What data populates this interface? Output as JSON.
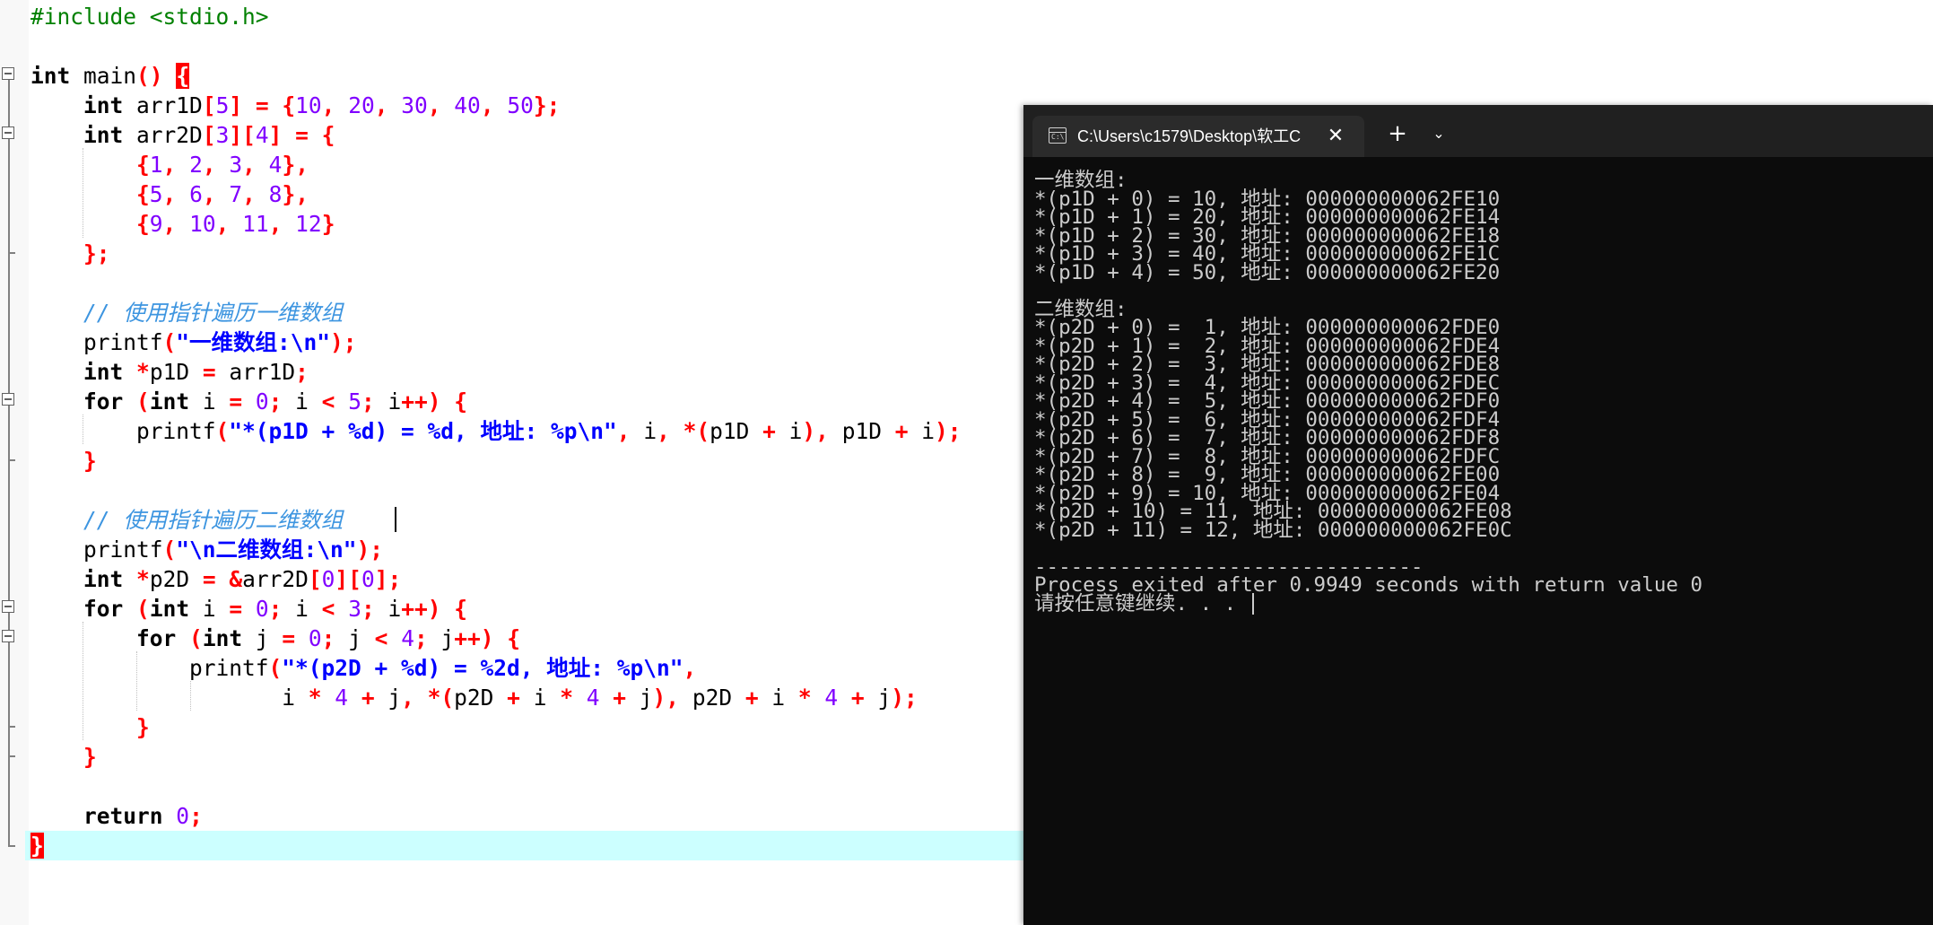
{
  "editor": {
    "lines": [
      [
        [
          "pp",
          "#include <stdio.h>"
        ]
      ],
      [],
      [
        [
          "kw",
          "int"
        ],
        [
          "id",
          " main"
        ],
        [
          "op",
          "()"
        ],
        [
          "id",
          " "
        ],
        [
          "brace-hl",
          "{"
        ]
      ],
      [
        [
          "id",
          "    "
        ],
        [
          "kw",
          "int"
        ],
        [
          "id",
          " arr1D"
        ],
        [
          "op",
          "["
        ],
        [
          "num",
          "5"
        ],
        [
          "op",
          "]"
        ],
        [
          "id",
          " "
        ],
        [
          "op",
          "="
        ],
        [
          "id",
          " "
        ],
        [
          "op",
          "{"
        ],
        [
          "num",
          "10"
        ],
        [
          "op",
          ","
        ],
        [
          "id",
          " "
        ],
        [
          "num",
          "20"
        ],
        [
          "op",
          ","
        ],
        [
          "id",
          " "
        ],
        [
          "num",
          "30"
        ],
        [
          "op",
          ","
        ],
        [
          "id",
          " "
        ],
        [
          "num",
          "40"
        ],
        [
          "op",
          ","
        ],
        [
          "id",
          " "
        ],
        [
          "num",
          "50"
        ],
        [
          "op",
          "};"
        ]
      ],
      [
        [
          "id",
          "    "
        ],
        [
          "kw",
          "int"
        ],
        [
          "id",
          " arr2D"
        ],
        [
          "op",
          "["
        ],
        [
          "num",
          "3"
        ],
        [
          "op",
          "]["
        ],
        [
          "num",
          "4"
        ],
        [
          "op",
          "]"
        ],
        [
          "id",
          " "
        ],
        [
          "op",
          "="
        ],
        [
          "id",
          " "
        ],
        [
          "op",
          "{"
        ]
      ],
      [
        [
          "id",
          "        "
        ],
        [
          "op",
          "{"
        ],
        [
          "num",
          "1"
        ],
        [
          "op",
          ","
        ],
        [
          "id",
          " "
        ],
        [
          "num",
          "2"
        ],
        [
          "op",
          ","
        ],
        [
          "id",
          " "
        ],
        [
          "num",
          "3"
        ],
        [
          "op",
          ","
        ],
        [
          "id",
          " "
        ],
        [
          "num",
          "4"
        ],
        [
          "op",
          "},"
        ]
      ],
      [
        [
          "id",
          "        "
        ],
        [
          "op",
          "{"
        ],
        [
          "num",
          "5"
        ],
        [
          "op",
          ","
        ],
        [
          "id",
          " "
        ],
        [
          "num",
          "6"
        ],
        [
          "op",
          ","
        ],
        [
          "id",
          " "
        ],
        [
          "num",
          "7"
        ],
        [
          "op",
          ","
        ],
        [
          "id",
          " "
        ],
        [
          "num",
          "8"
        ],
        [
          "op",
          "},"
        ]
      ],
      [
        [
          "id",
          "        "
        ],
        [
          "op",
          "{"
        ],
        [
          "num",
          "9"
        ],
        [
          "op",
          ","
        ],
        [
          "id",
          " "
        ],
        [
          "num",
          "10"
        ],
        [
          "op",
          ","
        ],
        [
          "id",
          " "
        ],
        [
          "num",
          "11"
        ],
        [
          "op",
          ","
        ],
        [
          "id",
          " "
        ],
        [
          "num",
          "12"
        ],
        [
          "op",
          "}"
        ]
      ],
      [
        [
          "id",
          "    "
        ],
        [
          "op",
          "};"
        ]
      ],
      [],
      [
        [
          "id",
          "    "
        ],
        [
          "cmt",
          "// 使用指针遍历一维数组"
        ]
      ],
      [
        [
          "id",
          "    printf"
        ],
        [
          "op",
          "("
        ],
        [
          "str",
          "\"一维数组:\\n\""
        ],
        [
          "op",
          ");"
        ]
      ],
      [
        [
          "id",
          "    "
        ],
        [
          "kw",
          "int"
        ],
        [
          "id",
          " "
        ],
        [
          "op",
          "*"
        ],
        [
          "id",
          "p1D "
        ],
        [
          "op",
          "="
        ],
        [
          "id",
          " arr1D"
        ],
        [
          "op",
          ";"
        ]
      ],
      [
        [
          "id",
          "    "
        ],
        [
          "kw",
          "for"
        ],
        [
          "id",
          " "
        ],
        [
          "op",
          "("
        ],
        [
          "kw",
          "int"
        ],
        [
          "id",
          " i "
        ],
        [
          "op",
          "="
        ],
        [
          "id",
          " "
        ],
        [
          "num",
          "0"
        ],
        [
          "op",
          ";"
        ],
        [
          "id",
          " i "
        ],
        [
          "op",
          "<"
        ],
        [
          "id",
          " "
        ],
        [
          "num",
          "5"
        ],
        [
          "op",
          ";"
        ],
        [
          "id",
          " i"
        ],
        [
          "op",
          "++)"
        ],
        [
          "id",
          " "
        ],
        [
          "op",
          "{"
        ]
      ],
      [
        [
          "id",
          "        printf"
        ],
        [
          "op",
          "("
        ],
        [
          "str",
          "\"*(p1D + %d) = %d, 地址: %p\\n\""
        ],
        [
          "op",
          ","
        ],
        [
          "id",
          " i"
        ],
        [
          "op",
          ","
        ],
        [
          "id",
          " "
        ],
        [
          "op",
          "*("
        ],
        [
          "id",
          "p1D "
        ],
        [
          "op",
          "+"
        ],
        [
          "id",
          " i"
        ],
        [
          "op",
          "),"
        ],
        [
          "id",
          " p1D "
        ],
        [
          "op",
          "+"
        ],
        [
          "id",
          " i"
        ],
        [
          "op",
          ");"
        ]
      ],
      [
        [
          "id",
          "    "
        ],
        [
          "op",
          "}"
        ]
      ],
      [],
      [
        [
          "id",
          "    "
        ],
        [
          "cmt",
          "// 使用指针遍历二维数组"
        ]
      ],
      [
        [
          "id",
          "    printf"
        ],
        [
          "op",
          "("
        ],
        [
          "str",
          "\"\\n二维数组:\\n\""
        ],
        [
          "op",
          ");"
        ]
      ],
      [
        [
          "id",
          "    "
        ],
        [
          "kw",
          "int"
        ],
        [
          "id",
          " "
        ],
        [
          "op",
          "*"
        ],
        [
          "id",
          "p2D "
        ],
        [
          "op",
          "="
        ],
        [
          "id",
          " "
        ],
        [
          "op",
          "&"
        ],
        [
          "id",
          "arr2D"
        ],
        [
          "op",
          "["
        ],
        [
          "num",
          "0"
        ],
        [
          "op",
          "]["
        ],
        [
          "num",
          "0"
        ],
        [
          "op",
          "];"
        ]
      ],
      [
        [
          "id",
          "    "
        ],
        [
          "kw",
          "for"
        ],
        [
          "id",
          " "
        ],
        [
          "op",
          "("
        ],
        [
          "kw",
          "int"
        ],
        [
          "id",
          " i "
        ],
        [
          "op",
          "="
        ],
        [
          "id",
          " "
        ],
        [
          "num",
          "0"
        ],
        [
          "op",
          ";"
        ],
        [
          "id",
          " i "
        ],
        [
          "op",
          "<"
        ],
        [
          "id",
          " "
        ],
        [
          "num",
          "3"
        ],
        [
          "op",
          ";"
        ],
        [
          "id",
          " i"
        ],
        [
          "op",
          "++)"
        ],
        [
          "id",
          " "
        ],
        [
          "op",
          "{"
        ]
      ],
      [
        [
          "id",
          "        "
        ],
        [
          "kw",
          "for"
        ],
        [
          "id",
          " "
        ],
        [
          "op",
          "("
        ],
        [
          "kw",
          "int"
        ],
        [
          "id",
          " j "
        ],
        [
          "op",
          "="
        ],
        [
          "id",
          " "
        ],
        [
          "num",
          "0"
        ],
        [
          "op",
          ";"
        ],
        [
          "id",
          " j "
        ],
        [
          "op",
          "<"
        ],
        [
          "id",
          " "
        ],
        [
          "num",
          "4"
        ],
        [
          "op",
          ";"
        ],
        [
          "id",
          " j"
        ],
        [
          "op",
          "++)"
        ],
        [
          "id",
          " "
        ],
        [
          "op",
          "{"
        ]
      ],
      [
        [
          "id",
          "            printf"
        ],
        [
          "op",
          "("
        ],
        [
          "str",
          "\"*(p2D + %d) = %2d, 地址: %p\\n\""
        ],
        [
          "op",
          ","
        ]
      ],
      [
        [
          "id",
          "                   i "
        ],
        [
          "op",
          "*"
        ],
        [
          "id",
          " "
        ],
        [
          "num",
          "4"
        ],
        [
          "id",
          " "
        ],
        [
          "op",
          "+"
        ],
        [
          "id",
          " j"
        ],
        [
          "op",
          ","
        ],
        [
          "id",
          " "
        ],
        [
          "op",
          "*("
        ],
        [
          "id",
          "p2D "
        ],
        [
          "op",
          "+"
        ],
        [
          "id",
          " i "
        ],
        [
          "op",
          "*"
        ],
        [
          "id",
          " "
        ],
        [
          "num",
          "4"
        ],
        [
          "id",
          " "
        ],
        [
          "op",
          "+"
        ],
        [
          "id",
          " j"
        ],
        [
          "op",
          "),"
        ],
        [
          "id",
          " p2D "
        ],
        [
          "op",
          "+"
        ],
        [
          "id",
          " i "
        ],
        [
          "op",
          "*"
        ],
        [
          "id",
          " "
        ],
        [
          "num",
          "4"
        ],
        [
          "id",
          " "
        ],
        [
          "op",
          "+"
        ],
        [
          "id",
          " j"
        ],
        [
          "op",
          ");"
        ]
      ],
      [
        [
          "id",
          "        "
        ],
        [
          "op",
          "}"
        ]
      ],
      [
        [
          "id",
          "    "
        ],
        [
          "op",
          "}"
        ]
      ],
      [],
      [
        [
          "id",
          "    "
        ],
        [
          "kw",
          "return"
        ],
        [
          "id",
          " "
        ],
        [
          "num",
          "0"
        ],
        [
          "op",
          ";"
        ]
      ],
      [
        [
          "brace-hl",
          "}"
        ]
      ]
    ]
  },
  "terminal": {
    "tab_title": "C:\\Users\\c1579\\Desktop\\软工C",
    "close_glyph": "✕",
    "new_tab_glyph": "+",
    "menu_glyph": "⌄",
    "icon_text": "C:\\",
    "lines": [
      "一维数组:",
      "*(p1D + 0) = 10, 地址: 000000000062FE10",
      "*(p1D + 1) = 20, 地址: 000000000062FE14",
      "*(p1D + 2) = 30, 地址: 000000000062FE18",
      "*(p1D + 3) = 40, 地址: 000000000062FE1C",
      "*(p1D + 4) = 50, 地址: 000000000062FE20",
      "",
      "二维数组:",
      "*(p2D + 0) =  1, 地址: 000000000062FDE0",
      "*(p2D + 1) =  2, 地址: 000000000062FDE4",
      "*(p2D + 2) =  3, 地址: 000000000062FDE8",
      "*(p2D + 3) =  4, 地址: 000000000062FDEC",
      "*(p2D + 4) =  5, 地址: 000000000062FDF0",
      "*(p2D + 5) =  6, 地址: 000000000062FDF4",
      "*(p2D + 6) =  7, 地址: 000000000062FDF8",
      "*(p2D + 7) =  8, 地址: 000000000062FDFC",
      "*(p2D + 8) =  9, 地址: 000000000062FE00",
      "*(p2D + 9) = 10, 地址: 000000000062FE04",
      "*(p2D + 10) = 11, 地址: 000000000062FE08",
      "*(p2D + 11) = 12, 地址: 000000000062FE0C",
      "",
      "--------------------------------",
      "Process exited after 0.9949 seconds with return value 0",
      "请按任意键继续. . . "
    ]
  }
}
